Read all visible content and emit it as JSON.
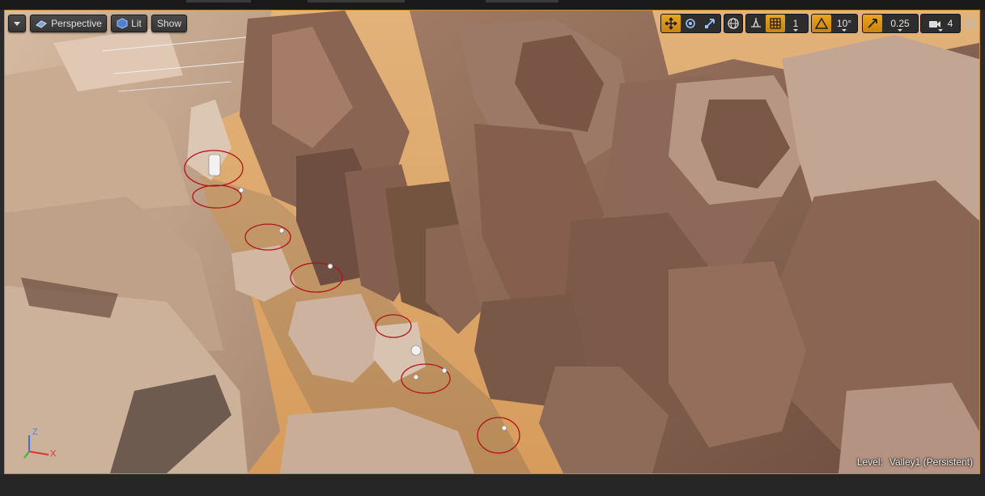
{
  "viewport": {
    "view_mode": "Perspective",
    "lighting_mode": "Lit",
    "show_menu": "Show",
    "grid_snap_value": "1",
    "rotation_snap_value": "10°",
    "scale_snap_value": "0.25",
    "camera_speed": "4",
    "axis_z": "Z",
    "axis_x": "X",
    "level_label": "Level:",
    "level_name": "Valley1 (Persistent)"
  },
  "colors": {
    "accent": "#c2901c",
    "active_button": "#e6a21e",
    "actor_marker": "#b0141a"
  },
  "icons": {
    "menu": "chevron-down-icon",
    "perspective": "cube-wire-icon",
    "lit": "cube-solid-icon",
    "translate": "translate-arrows-icon",
    "rotate": "rotate-icon",
    "scale": "scale-icon",
    "world": "globe-icon",
    "surface_snap": "surface-snap-icon",
    "grid": "grid-icon",
    "rotation_snap": "angle-triangle-icon",
    "scale_snap": "scale-arrow-icon",
    "camera_speed": "camera-icon",
    "maximize": "maximize-icon"
  }
}
